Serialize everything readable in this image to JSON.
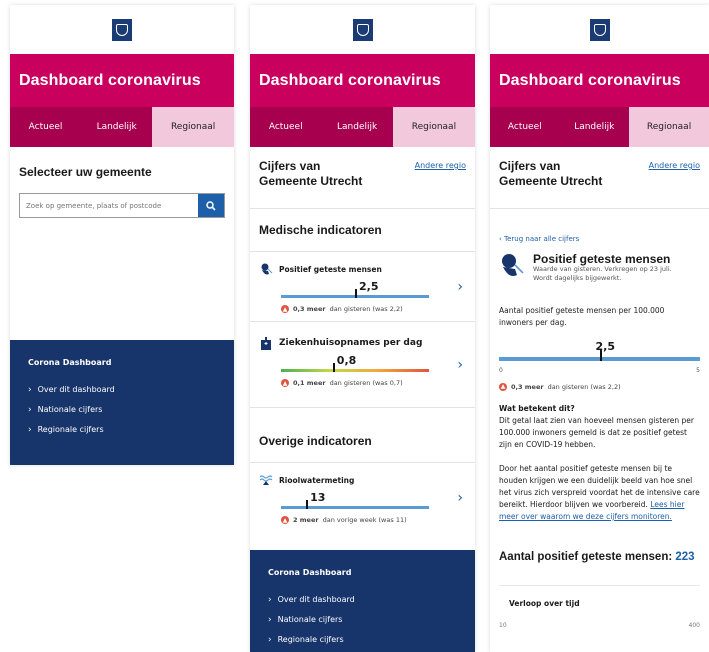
{
  "app": {
    "title": "Dashboard coronavirus",
    "tabs": [
      "Actueel",
      "Landelijk",
      "Regionaal"
    ],
    "active_tab": "Regionaal"
  },
  "colors": {
    "brand": "#c9005e",
    "tab_bar": "#a6004e",
    "tab_active": "#f1c8dc",
    "footer": "#17346b",
    "link": "#1d5fa8"
  },
  "panel1": {
    "heading": "Selecteer uw gemeente",
    "search_placeholder": "Zoek op gemeente, plaats of postcode",
    "search_icon": "search-icon"
  },
  "footer": {
    "title": "Corona Dashboard",
    "links": [
      "Over dit dashboard",
      "Nationale cijfers",
      "Regionale cijfers"
    ]
  },
  "panel2": {
    "region_title_1": "Cijfers van",
    "region_title_2": "Gemeente Utrecht",
    "region_link": "Andere regio",
    "medical_heading": "Medische indicatoren",
    "other_heading": "Overige indicatoren",
    "indicators": [
      {
        "title": "Positief geteste mensen",
        "value": "2,5",
        "delta_bold": "0,3 meer",
        "delta_text": " dan gisteren (was 2,2)",
        "icon": "person-test-icon",
        "level": 0.5
      },
      {
        "title": "Ziekenhuisopnames per dag",
        "value": "0,8",
        "delta_bold": "0,1 meer",
        "delta_text": " dan gisteren (was 0,7)",
        "icon": "hospital-icon",
        "level": 0.35
      },
      {
        "title": "Rioolwatermeting",
        "value": "13",
        "delta_bold": "2 meer",
        "delta_text": " dan vorige week (was 11)",
        "icon": "sewer-icon",
        "level": 0.17
      }
    ]
  },
  "panel3": {
    "region_title_1": "Cijfers van",
    "region_title_2": "Gemeente Utrecht",
    "region_link": "Andere regio",
    "back_link": "Terug naar alle cijfers",
    "title": "Positief geteste mensen",
    "subtitle_1": "Waarde van gisteren. Verkregen op 23 juli.",
    "subtitle_2": "Wordt dagelijks bijgewerkt.",
    "metric_desc_1": "Aantal positief geteste mensen per 100.000",
    "metric_desc_2": "inwoners per dag.",
    "value": "2,5",
    "axis_min": "0",
    "axis_max": "5",
    "level": 0.5,
    "delta_bold": "0,3 meer",
    "delta_text": " dan gisteren (was 2,2)",
    "question": "Wat betekent dit?",
    "para1": "Dit getal laat zien van hoeveel mensen gisteren per 100.000 inwoners gemeld is dat ze positief getest zijn en COVID-19 hebben.",
    "para2": "Door het aantal positief geteste mensen bij te houden krijgen we een duidelijk beeld van hoe snel het virus zich verspreid voordat het de intensive care bereikt. Hierdoor blijven we voorbereid.",
    "para2_link": "Lees hier meer over waarom we deze cijfers monitoren.",
    "total_label": "Aantal positief geteste mensen: ",
    "total_value": "223",
    "chart_title": "Verloop over tijd",
    "chart_left": "10",
    "chart_right": "400"
  }
}
